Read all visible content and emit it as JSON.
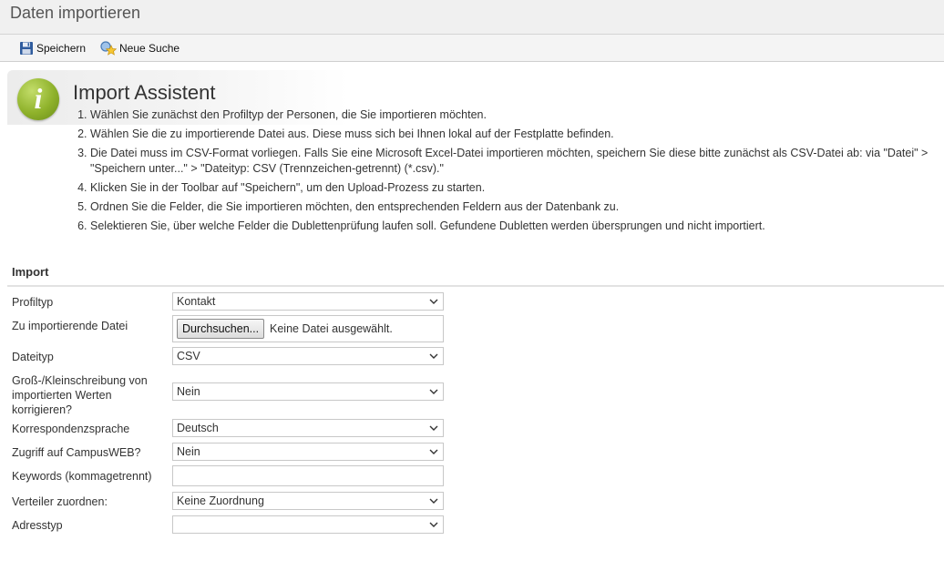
{
  "page": {
    "title": "Daten importieren"
  },
  "toolbar": {
    "save_label": "Speichern",
    "new_search_label": "Neue Suche"
  },
  "assistant": {
    "icon_letter": "i",
    "title": "Import Assistent",
    "steps": [
      "Wählen Sie zunächst den Profiltyp der Personen, die Sie importieren möchten.",
      "Wählen Sie die zu importierende Datei aus. Diese muss sich bei Ihnen lokal auf der Festplatte befinden.",
      "Die Datei muss im CSV-Format vorliegen. Falls Sie eine Microsoft Excel-Datei importieren möchten, speichern Sie diese bitte zunächst als CSV-Datei ab: via \"Datei\" > \"Speichern unter...\" > \"Dateityp: CSV (Trennzeichen-getrennt) (*.csv).\"",
      "Klicken Sie in der Toolbar auf \"Speichern\", um den Upload-Prozess zu starten.",
      "Ordnen Sie die Felder, die Sie importieren möchten, den entsprechenden Feldern aus der Datenbank zu.",
      "Selektieren Sie, über welche Felder die Dublettenprüfung laufen soll. Gefundene Dubletten werden übersprungen und nicht importiert."
    ]
  },
  "form": {
    "section_title": "Import",
    "profiltyp": {
      "label": "Profiltyp",
      "value": "Kontakt"
    },
    "datei": {
      "label": "Zu importierende Datei",
      "button": "Durchsuchen...",
      "status": "Keine Datei ausgewählt."
    },
    "dateityp": {
      "label": "Dateityp",
      "value": "CSV"
    },
    "gross": {
      "label": "Groß-/Kleinschreibung von importierten Werten korrigieren?",
      "value": "Nein"
    },
    "sprache": {
      "label": "Korrespondenzsprache",
      "value": "Deutsch"
    },
    "zugriff": {
      "label": "Zugriff auf CampusWEB?",
      "value": "Nein"
    },
    "keywords": {
      "label": "Keywords (kommagetrennt)",
      "value": ""
    },
    "verteiler": {
      "label": "Verteiler zuordnen:",
      "value": "Keine Zuordnung"
    },
    "adresstyp": {
      "label": "Adresstyp",
      "value": ""
    }
  },
  "colors": {
    "accent_green": "#8fb22b",
    "header_bg": "#f0f0f0"
  }
}
